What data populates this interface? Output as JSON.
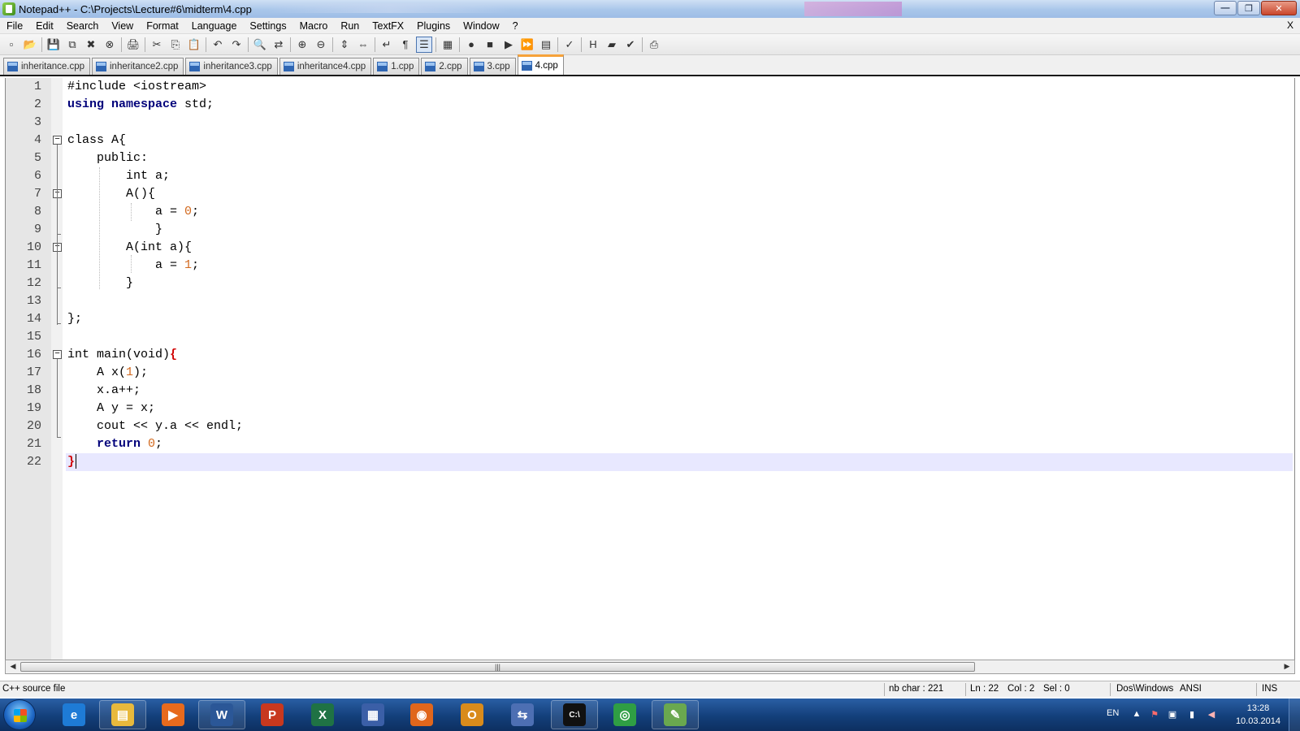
{
  "window": {
    "title": "Notepad++ - C:\\Projects\\Lecture#6\\midterm\\4.cpp",
    "buttons": {
      "minimize": "—",
      "maximize": "❐",
      "close": "✕"
    }
  },
  "menu": {
    "items": [
      "File",
      "Edit",
      "Search",
      "View",
      "Format",
      "Language",
      "Settings",
      "Macro",
      "Run",
      "TextFX",
      "Plugins",
      "Window",
      "?"
    ],
    "close": "X"
  },
  "toolbar": {
    "icons": [
      "new-file",
      "open-file",
      "save",
      "save-all",
      "close",
      "close-all",
      "print",
      "cut",
      "copy",
      "paste",
      "undo",
      "redo",
      "find",
      "replace",
      "zoom-in",
      "zoom-out",
      "sync-vertical",
      "sync-horizontal",
      "word-wrap",
      "show-all-chars",
      "indent-guide",
      "user-define",
      "record-macro",
      "stop-macro",
      "play-macro",
      "run-macro-multiple",
      "save-macro",
      "spellcheck",
      "html-tag",
      "folder",
      "check",
      "print-now"
    ],
    "glyphs": [
      "▫",
      "📂",
      "💾",
      "⧉",
      "✖",
      "⊗",
      "🖨",
      "✂",
      "⎘",
      "📋",
      "↶",
      "↷",
      "🔍",
      "⇄",
      "⊕",
      "⊖",
      "⇕",
      "⇔",
      "↵",
      "¶",
      "☰",
      "▦",
      "●",
      "■",
      "▶",
      "⏩",
      "▤",
      "✓",
      "H",
      "▰",
      "✔",
      "⎙"
    ]
  },
  "tabs": [
    {
      "label": "inheritance.cpp",
      "active": false
    },
    {
      "label": "inheritance2.cpp",
      "active": false
    },
    {
      "label": "inheritance3.cpp",
      "active": false
    },
    {
      "label": "inheritance4.cpp",
      "active": false
    },
    {
      "label": "1.cpp",
      "active": false
    },
    {
      "label": "2.cpp",
      "active": false
    },
    {
      "label": "3.cpp",
      "active": false
    },
    {
      "label": "4.cpp",
      "active": true
    }
  ],
  "editor": {
    "current_line": 22,
    "lines": [
      {
        "n": "1",
        "fold": "",
        "segs": [
          {
            "t": "#include <iostream>",
            "c": ""
          }
        ]
      },
      {
        "n": "2",
        "fold": "",
        "segs": [
          {
            "t": "using namespace",
            "c": "kw"
          },
          {
            "t": " std;",
            "c": ""
          }
        ]
      },
      {
        "n": "3",
        "fold": "",
        "segs": [
          {
            "t": "",
            "c": ""
          }
        ]
      },
      {
        "n": "4",
        "fold": "−",
        "segs": [
          {
            "t": "class",
            "c": ""
          },
          {
            "t": " A{",
            "c": ""
          }
        ]
      },
      {
        "n": "5",
        "fold": "",
        "segs": [
          {
            "t": "    public:",
            "c": ""
          }
        ]
      },
      {
        "n": "6",
        "fold": "",
        "segs": [
          {
            "t": "        int",
            "c": ""
          },
          {
            "t": " a;",
            "c": ""
          }
        ]
      },
      {
        "n": "7",
        "fold": "−",
        "segs": [
          {
            "t": "        A(){",
            "c": ""
          }
        ]
      },
      {
        "n": "8",
        "fold": "",
        "segs": [
          {
            "t": "            a = ",
            "c": ""
          },
          {
            "t": "0",
            "c": "num"
          },
          {
            "t": ";",
            "c": ""
          }
        ]
      },
      {
        "n": "9",
        "fold": "",
        "segs": [
          {
            "t": "            }",
            "c": ""
          }
        ]
      },
      {
        "n": "10",
        "fold": "−",
        "segs": [
          {
            "t": "        A(int a){",
            "c": ""
          }
        ]
      },
      {
        "n": "11",
        "fold": "",
        "segs": [
          {
            "t": "            a = ",
            "c": ""
          },
          {
            "t": "1",
            "c": "num"
          },
          {
            "t": ";",
            "c": ""
          }
        ]
      },
      {
        "n": "12",
        "fold": "",
        "segs": [
          {
            "t": "        }",
            "c": ""
          }
        ]
      },
      {
        "n": "13",
        "fold": "",
        "segs": [
          {
            "t": "",
            "c": ""
          }
        ]
      },
      {
        "n": "14",
        "fold": "",
        "segs": [
          {
            "t": "};",
            "c": ""
          }
        ]
      },
      {
        "n": "15",
        "fold": "",
        "segs": [
          {
            "t": "",
            "c": ""
          }
        ]
      },
      {
        "n": "16",
        "fold": "−",
        "segs": [
          {
            "t": "int main(void)",
            "c": ""
          },
          {
            "t": "{",
            "c": "brace-hl"
          }
        ]
      },
      {
        "n": "17",
        "fold": "",
        "segs": [
          {
            "t": "    A x(",
            "c": ""
          },
          {
            "t": "1",
            "c": "num"
          },
          {
            "t": ");",
            "c": ""
          }
        ]
      },
      {
        "n": "18",
        "fold": "",
        "segs": [
          {
            "t": "    x.a++;",
            "c": ""
          }
        ]
      },
      {
        "n": "19",
        "fold": "",
        "segs": [
          {
            "t": "    A y = x;",
            "c": ""
          }
        ]
      },
      {
        "n": "20",
        "fold": "",
        "segs": [
          {
            "t": "    cout << y.a << endl;",
            "c": ""
          }
        ]
      },
      {
        "n": "21",
        "fold": "",
        "segs": [
          {
            "t": "    return",
            "c": "kw"
          },
          {
            "t": " ",
            "c": ""
          },
          {
            "t": "0",
            "c": "num"
          },
          {
            "t": ";",
            "c": ""
          }
        ]
      },
      {
        "n": "22",
        "fold": "",
        "segs": [
          {
            "t": "}",
            "c": "brace-hl"
          }
        ]
      }
    ]
  },
  "scrollbar": {
    "left_arrow": "◀",
    "right_arrow": "▶",
    "grip": "|||"
  },
  "status": {
    "file_type": "C++ source file",
    "nb_char": "nb char : 221",
    "ln": "Ln : 22",
    "col": "Col : 2",
    "sel": "Sel : 0",
    "eol": "Dos\\Windows",
    "encoding": "ANSI",
    "mode": "INS"
  },
  "taskbar": {
    "apps": [
      {
        "name": "internet-explorer-icon",
        "glyph": "e",
        "color": "#1e7bd6",
        "pinned": false
      },
      {
        "name": "windows-explorer-icon",
        "glyph": "▤",
        "color": "#e8b93c",
        "pinned": true
      },
      {
        "name": "media-player-icon",
        "glyph": "▶",
        "color": "#e76a1d",
        "pinned": false
      },
      {
        "name": "word-icon",
        "glyph": "W",
        "color": "#2b5797",
        "pinned": true
      },
      {
        "name": "powerpoint-icon",
        "glyph": "P",
        "color": "#c8381e",
        "pinned": false
      },
      {
        "name": "excel-icon",
        "glyph": "X",
        "color": "#1f7244",
        "pinned": false
      },
      {
        "name": "calculator-icon",
        "glyph": "▦",
        "color": "#3b5fa7",
        "pinned": false
      },
      {
        "name": "firefox-icon",
        "glyph": "◉",
        "color": "#e0661c",
        "pinned": false
      },
      {
        "name": "outlook-icon",
        "glyph": "O",
        "color": "#d98b1b",
        "pinned": false
      },
      {
        "name": "visual-studio-icon",
        "glyph": "⇆",
        "color": "#4d6fb3",
        "pinned": false
      },
      {
        "name": "command-prompt-icon",
        "glyph": "C:\\",
        "color": "#111111",
        "pinned": true
      },
      {
        "name": "chrome-icon",
        "glyph": "◎",
        "color": "#2f9e44",
        "pinned": false
      },
      {
        "name": "notepad-plus-plus-icon",
        "glyph": "✎",
        "color": "#6aa84f",
        "pinned": true
      }
    ],
    "lang": "EN",
    "time": "13:28",
    "date": "10.03.2014"
  }
}
